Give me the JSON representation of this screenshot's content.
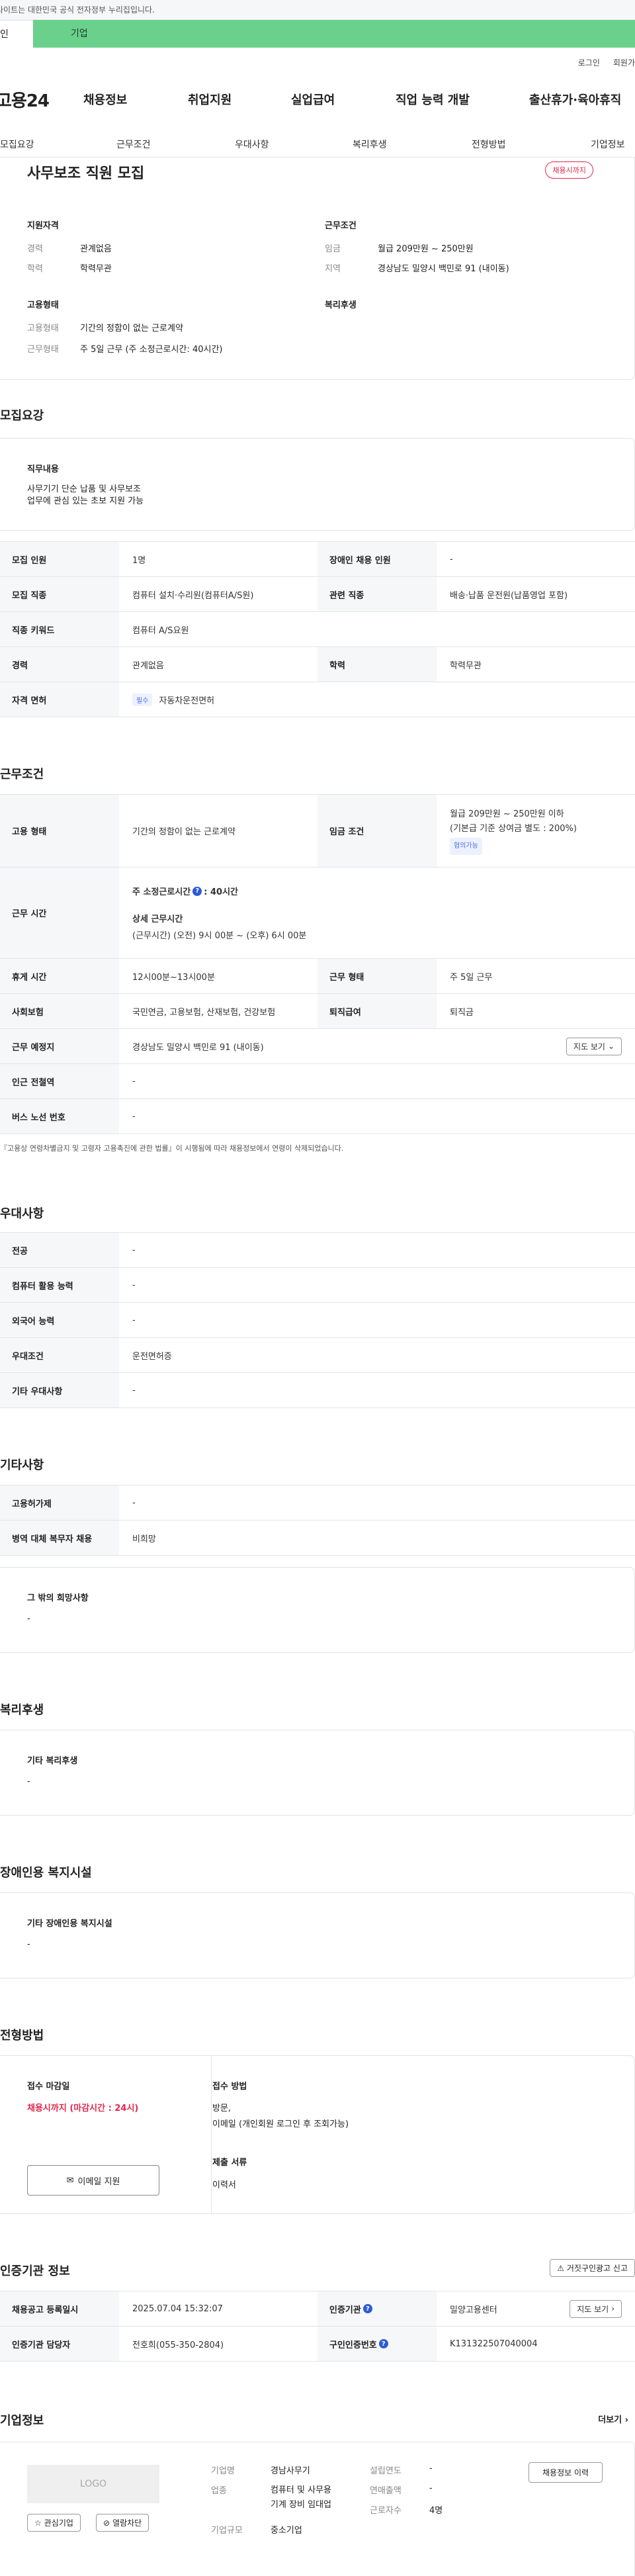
{
  "topbar": {
    "notice": "사이트는 대한민국 공식 전자정부 누리집입니다."
  },
  "service_tabs": [
    "인",
    "기업"
  ],
  "util_links": [
    "로그인",
    "회원가"
  ],
  "gnb": {
    "logo": "고용24",
    "items": [
      "채용정보",
      "취업지원",
      "실업급여",
      "직업 능력 개발",
      "출산휴가·육아휴직"
    ]
  },
  "subtabs": [
    "모집요강",
    "근무조건",
    "우대사항",
    "복리후생",
    "전형방법",
    "기업정보"
  ],
  "summary": {
    "title": "사무보조 직원 모집",
    "status_badge": "채용시까지",
    "left_group_title": "지원자격",
    "career_label": "경력",
    "career_value": "관계없음",
    "edu_label": "학력",
    "edu_value": "학력무관",
    "employ_group_title": "고용형태",
    "employ_type_label": "고용형태",
    "employ_type_value": "기간의 정함이 없는 근로계약",
    "work_form_label": "근무형태",
    "work_form_value": "주 5일 근무 (주 소정근로시간: 40시간)",
    "right_group_title": "근무조건",
    "wage_label": "임금",
    "wage_value": "월급 209만원 ~ 250만원",
    "region_label": "지역",
    "region_value": "경상남도 밀양시 백민로 91 (내이동)",
    "welfare_group_title": "복리후생"
  },
  "recruit": {
    "heading": "모집요강",
    "duty_title": "직무내용",
    "duty_lines": [
      "사무기기 단순 납품 및 사무보조",
      "업무에 관심 있는 초보 지원 가능"
    ],
    "rows": [
      {
        "l1": "모집 인원",
        "v1": "1명",
        "l2": "장애인 채용 인원",
        "v2": "-"
      },
      {
        "l1": "모집 직종",
        "v1": "컴퓨터 설치·수리원(컴퓨터A/S원)",
        "l2": "관련 직종",
        "v2": "배송·납품 운전원(납품영업 포함)"
      },
      {
        "l1": "직종 키워드",
        "v1": "컴퓨터 A/S요원"
      },
      {
        "l1": "경력",
        "v1": "관계없음",
        "l2": "학력",
        "v2": "학력무관"
      },
      {
        "l1": "자격 면허",
        "badge": "필수",
        "v1": "자동차운전면허"
      }
    ]
  },
  "conditions": {
    "heading": "근무조건",
    "employ_type_label": "고용 형태",
    "employ_type_value": "기간의 정함이 없는 근로계약",
    "wage_label": "임금 조건",
    "wage_line1": "월급 209만원 ~ 250만원 이하",
    "wage_line2": "(기본급 기준 상여금 별도 : 200%)",
    "wage_badge": "협의가능",
    "hours_label": "근무 시간",
    "weekly_hours_title": "주 소정근로시간",
    "weekly_hours_value": ": 40시간",
    "detail_hours_title": "상세 근무시간",
    "detail_hours_value": "(근무시간) (오전) 9시 00분 ~ (오후) 6시 00분",
    "break_label": "휴게 시간",
    "break_value": "12시00분~13시00분",
    "work_form_label": "근무 형태",
    "work_form_value": "주 5일 근무",
    "insurance_label": "사회보험",
    "insurance_value": "국민연금, 고용보험, 산재보험, 건강보험",
    "severance_label": "퇴직급여",
    "severance_value": "퇴직금",
    "place_label": "근무 예정지",
    "place_value": "경상남도 밀양시 백민로 91 (내이동)",
    "map_button": "지도 보기",
    "subway_label": "인근 전철역",
    "subway_value": "-",
    "bus_label": "버스 노선 번호",
    "bus_value": "-",
    "footnote": "『고용상 연령차별금지 및 고령자 고용촉진에 관한 법률』이 시행됨에 따라 채용정보에서 연령이 삭제되었습니다."
  },
  "preferences": {
    "heading": "우대사항",
    "rows": [
      {
        "label": "전공",
        "value": "-"
      },
      {
        "label": "컴퓨터 활용 능력",
        "value": "-"
      },
      {
        "label": "외국어 능력",
        "value": "-"
      },
      {
        "label": "우대조건",
        "value": "운전면허증"
      },
      {
        "label": "기타 우대사항",
        "value": "-"
      }
    ]
  },
  "etc": {
    "heading": "기타사항",
    "rows": [
      {
        "label": "고용허가제",
        "value": "-"
      },
      {
        "label": "병역 대체 복무자 채용",
        "value": "비희망"
      }
    ],
    "other_title": "그 밖의 희망사항",
    "other_value": "-"
  },
  "welfare": {
    "heading": "복리후생",
    "box_title": "기타 복리후생",
    "box_value": "-"
  },
  "disability": {
    "heading": "장애인용 복지시설",
    "box_title": "기타 장애인용 복지시설",
    "box_value": "-"
  },
  "selection": {
    "heading": "전형방법",
    "deadline_title": "접수 마감일",
    "deadline_value": "채용시까지 (마감시간 : 24시)",
    "email_button": "이메일 지원",
    "method_title": "접수 방법",
    "method_line1": "방문,",
    "method_line2": "이메일 (개인회원 로그인 후 조회가능)",
    "docs_title": "제출 서류",
    "docs_value": "이력서"
  },
  "agency": {
    "heading": "인증기관 정보",
    "report_button": "거짓구인광고 신고",
    "reg_date_label": "채용공고 등록일시",
    "reg_date_value": "2025.07.04 15:32:07",
    "cert_org_label": "인증기관",
    "cert_org_value": "밀양고용센터",
    "cert_org_button": "지도 보기",
    "manager_label": "인증기관 담당자",
    "manager_value": "전호희(055-350-2804)",
    "cert_no_label": "구인인증번호",
    "cert_no_value": "K131322507040004"
  },
  "company": {
    "heading": "기업정보",
    "more_link": "더보기",
    "logo_text": "LOGO",
    "fav_button": "관심기업",
    "block_button": "열람차단",
    "name_label": "기업명",
    "name_value": "경남사무기",
    "industry_label": "업종",
    "industry_value_1": "컴퓨터 및 사무용",
    "industry_value_2": "기계 장비 임대업",
    "size_label": "기업규모",
    "size_value": "중소기업",
    "founded_label": "설립연도",
    "founded_value": "-",
    "sales_label": "연매출액",
    "sales_value": "-",
    "employees_label": "근로자수",
    "employees_value": "4명",
    "recruit_info_button": "채용정보 이력"
  }
}
